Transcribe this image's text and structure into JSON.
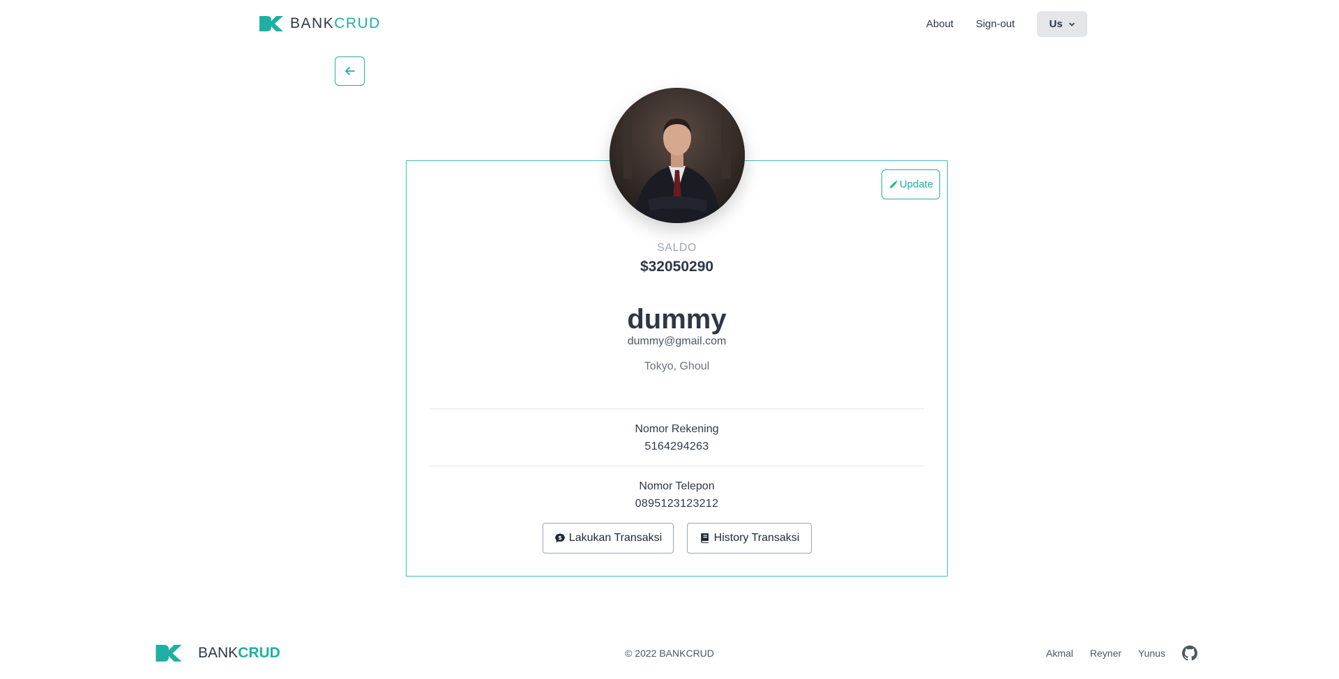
{
  "brand": {
    "name_plain": "BANK",
    "name_accent": "CRUD",
    "accent_color": "#1fb0a3"
  },
  "nav": {
    "about": "About",
    "signout": "Sign-out",
    "menu_label": "Us"
  },
  "profile": {
    "update_label": "Update",
    "saldo_label": "SALDO",
    "saldo_value": "$32050290",
    "name": "dummy",
    "email": "dummy@gmail.com",
    "location": "Tokyo, Ghoul",
    "rekening_label": "Nomor Rekening",
    "rekening_value": "5164294263",
    "telepon_label": "Nomor Telepon",
    "telepon_value": "0895123123212",
    "btn_transaksi": "Lakukan Transaksi",
    "btn_history": "History Transaksi"
  },
  "footer": {
    "brand_plain": "BANK",
    "brand_accent": "CRUD",
    "copyright": "© 2022 BANKCRUD",
    "links": [
      "Akmal",
      "Reyner",
      "Yunus"
    ]
  },
  "icons": {
    "back": "arrow-left-icon",
    "update": "pencil-icon",
    "transaksi": "chat-dollar-icon",
    "history": "book-icon",
    "github": "github-icon"
  }
}
